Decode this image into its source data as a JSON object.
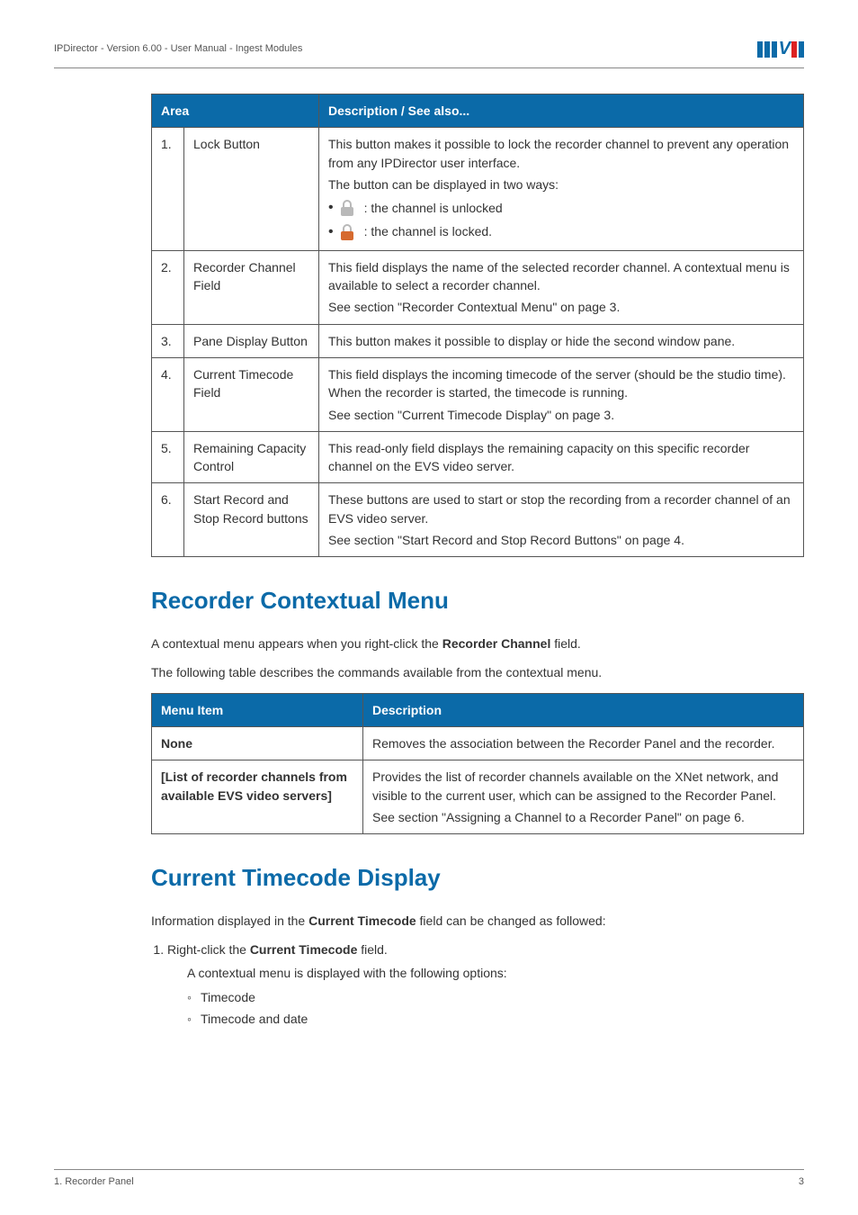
{
  "header": {
    "breadcrumb": "IPDirector - Version 6.00 - User Manual - Ingest Modules",
    "logo": "EVS"
  },
  "area_table": {
    "headers": {
      "area": "Area",
      "desc": "Description / See also..."
    },
    "rows": [
      {
        "num": "1.",
        "name": "Lock Button",
        "desc_intro": "This button makes it possible to lock the recorder channel to prevent any operation from any IPDirector user interface.",
        "desc_line2": "The button can be displayed in two ways:",
        "unlocked_text": ": the channel is unlocked",
        "locked_text": ": the channel is locked."
      },
      {
        "num": "2.",
        "name": "Recorder Channel Field",
        "desc": "This field displays the name of the selected recorder channel. A contextual menu is available to select a recorder channel.",
        "see": "See section \"Recorder Contextual Menu\" on page 3."
      },
      {
        "num": "3.",
        "name": "Pane Display Button",
        "desc": "This button makes it possible to display or hide the second window pane."
      },
      {
        "num": "4.",
        "name": "Current Timecode Field",
        "desc": "This field displays the incoming timecode of the server (should be the studio time). When the recorder is started, the timecode is running.",
        "see": "See section \"Current Timecode Display\" on page 3."
      },
      {
        "num": "5.",
        "name": "Remaining Capacity Control",
        "desc": "This read-only field displays the remaining capacity on this specific recorder channel on the EVS video server."
      },
      {
        "num": "6.",
        "name": "Start Record and Stop Record buttons",
        "desc": "These buttons are used to start or stop the recording from a recorder channel of an EVS video server.",
        "see": "See section \"Start Record and Stop Record Buttons\" on page 4."
      }
    ]
  },
  "section1": {
    "title": "Recorder Contextual Menu",
    "p1_a": "A contextual menu appears when you right-click the ",
    "p1_b": "Recorder Channel",
    "p1_c": " field.",
    "p2": "The following table describes the commands available from the contextual menu."
  },
  "menu_table": {
    "headers": {
      "item": "Menu Item",
      "desc": "Description"
    },
    "rows": [
      {
        "item": "None",
        "desc": "Removes the association between the Recorder Panel and the recorder."
      },
      {
        "item": "[List of recorder channels from available EVS video servers]",
        "desc": "Provides the list of recorder channels available on the XNet network, and visible to the current user, which can be assigned to the Recorder Panel.",
        "see": "See section \"Assigning a Channel to a Recorder Panel\" on page 6."
      }
    ]
  },
  "section2": {
    "title": "Current Timecode Display",
    "p1_a": "Information displayed in the ",
    "p1_b": "Current Timecode",
    "p1_c": " field can be changed as followed:",
    "step1_a": "Right-click the ",
    "step1_b": "Current Timecode",
    "step1_c": " field.",
    "step1_sub": "A contextual menu is displayed with the following options:",
    "opts": [
      "Timecode",
      "Timecode and date"
    ]
  },
  "footer": {
    "left": "1. Recorder Panel",
    "right": "3"
  }
}
